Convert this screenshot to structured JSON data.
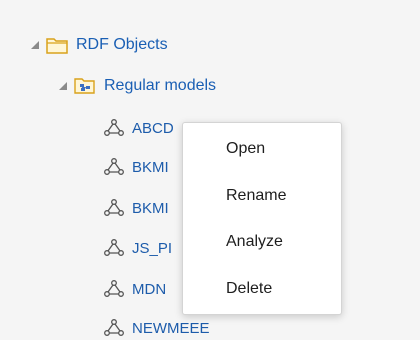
{
  "tree": {
    "root": {
      "label": "RDF Objects",
      "icon": "folder-icon",
      "expanded": true
    },
    "models_folder": {
      "label": "Regular models",
      "icon": "models-folder-icon",
      "expanded": true
    },
    "models": [
      {
        "label": "ABCD",
        "icon": "model-graph-icon"
      },
      {
        "label": "BKMI",
        "icon": "model-graph-icon"
      },
      {
        "label": "BKMI",
        "icon": "model-graph-icon"
      },
      {
        "label": "JS_PI",
        "icon": "model-graph-icon"
      },
      {
        "label": "MDN",
        "icon": "model-graph-icon"
      },
      {
        "label": "NEWMEEE",
        "icon": "model-graph-icon"
      }
    ]
  },
  "context_menu": {
    "items": [
      {
        "label": "Open"
      },
      {
        "label": "Rename"
      },
      {
        "label": "Analyze"
      },
      {
        "label": "Delete"
      }
    ]
  },
  "colors": {
    "link": "#1a5fb4",
    "folder": "#e6b422",
    "background": "#f5f5f5"
  }
}
